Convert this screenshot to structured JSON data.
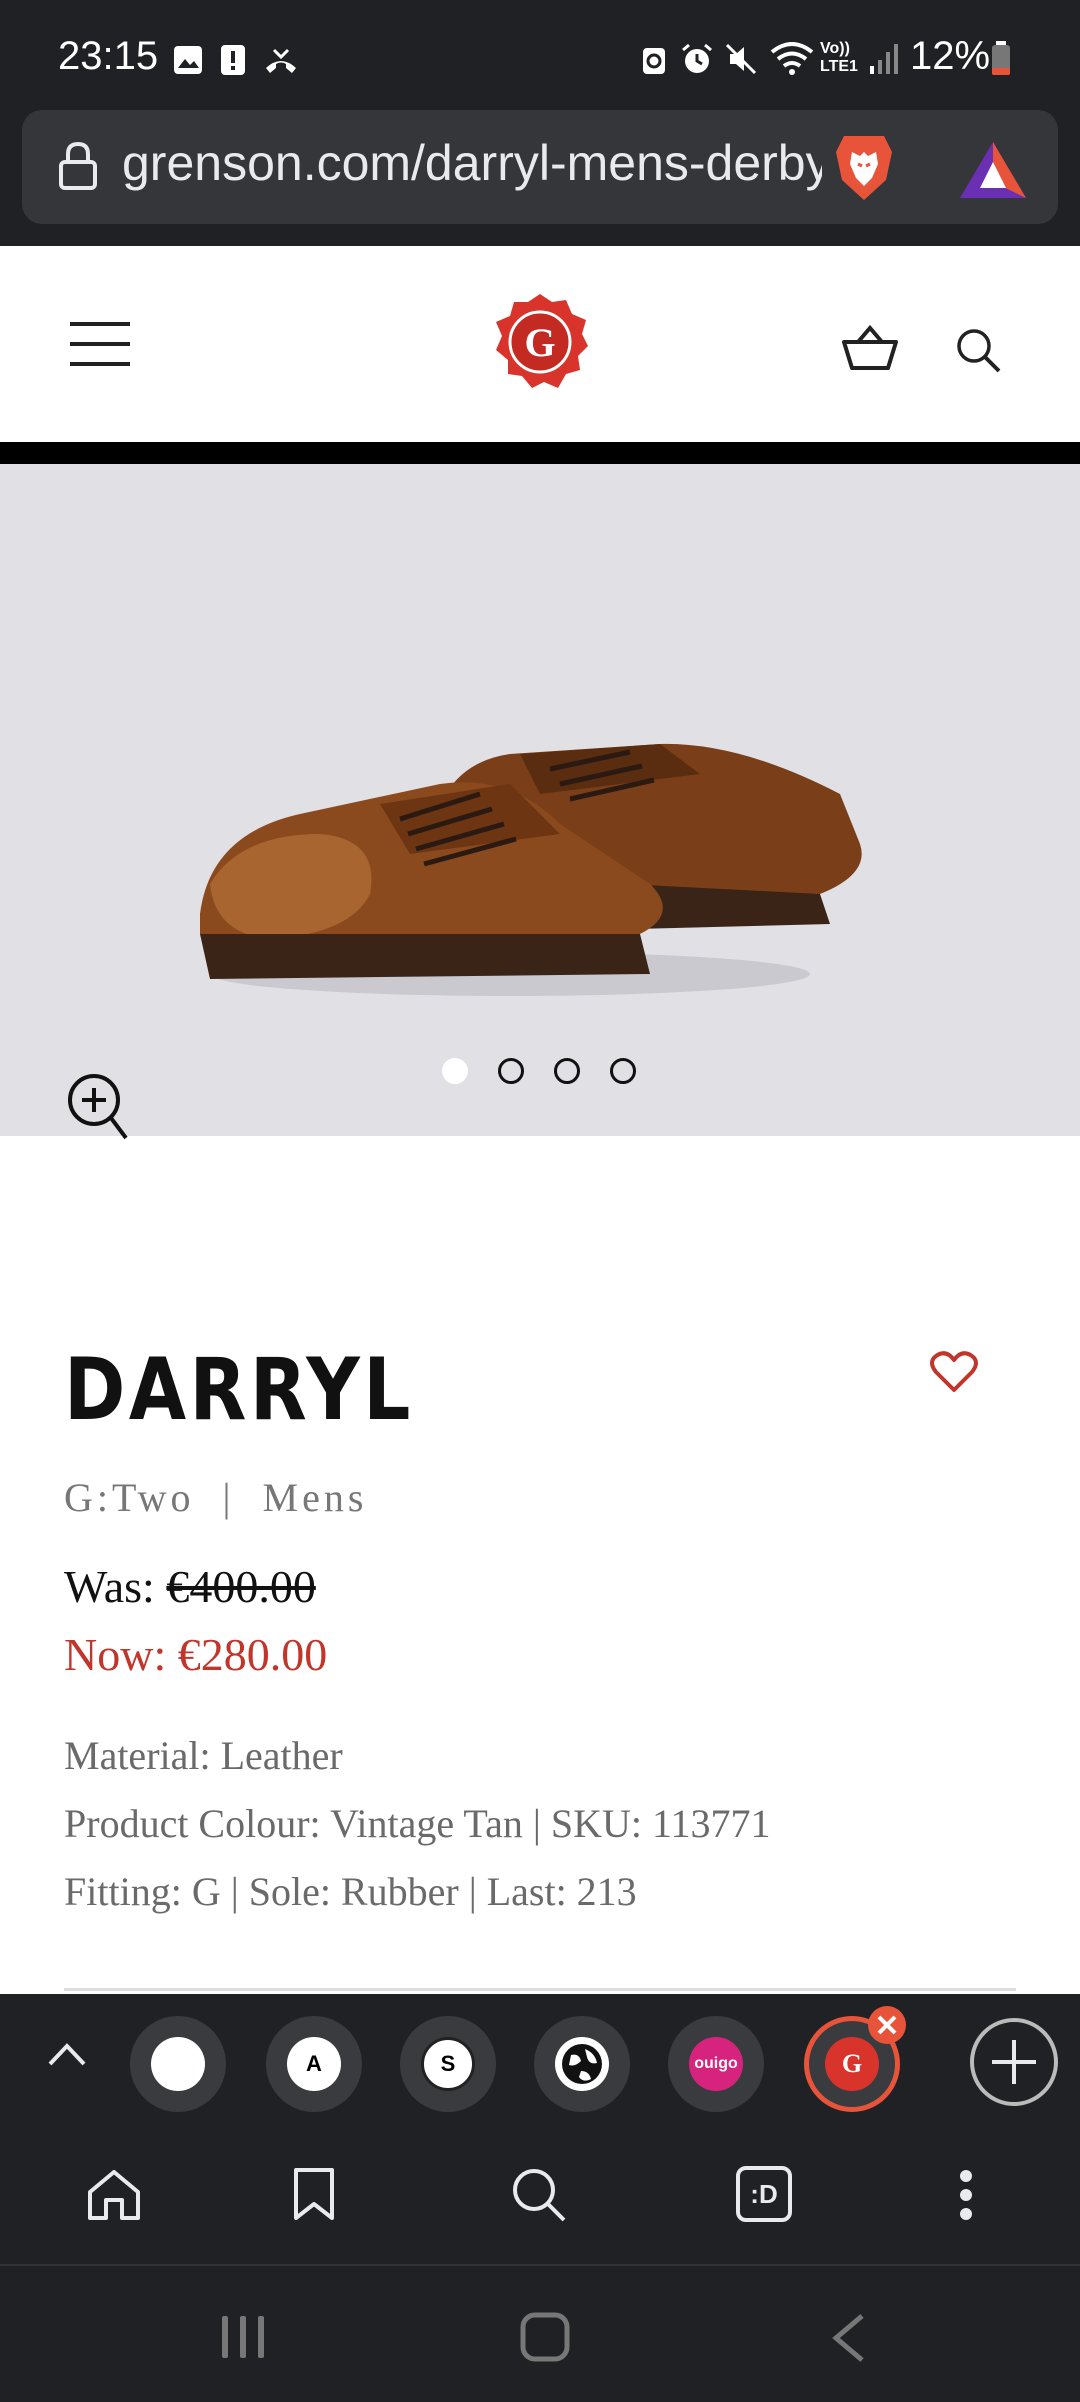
{
  "status_bar": {
    "time": "23:15",
    "battery": "12%",
    "icons": [
      "gallery-icon",
      "alert-icon",
      "missed-call-icon",
      "battery-saver-icon",
      "alarm-icon",
      "mute-icon",
      "wifi-icon",
      "volte-icon",
      "signal-icon",
      "battery-icon"
    ]
  },
  "browser": {
    "url": "grenson.com/darryl-mens-derby",
    "icons": [
      "lock-icon",
      "brave-shield-icon",
      "bat-rewards-icon"
    ]
  },
  "site_header": {
    "brand_letter": "G",
    "icons": [
      "menu-icon",
      "grenson-logo-icon",
      "basket-icon",
      "search-icon"
    ]
  },
  "product": {
    "title": "DARRYL",
    "meta": "G:Two  |  Mens",
    "was_label": "Was: ",
    "was_price": "€400.00",
    "now_price": "Now: €280.00",
    "material": "Material: Leather",
    "colour_sku": "Product Colour: Vintage Tan | SKU: 113771",
    "fitting": "Fitting: G | Sole: Rubber | Last: 213",
    "image_count": 4,
    "active_image": 1
  },
  "tab_strip": {
    "tabs": [
      {
        "label": ""
      },
      {
        "label": "A"
      },
      {
        "label": "S"
      },
      {
        "label": ""
      },
      {
        "label": "ouigo"
      },
      {
        "label": "G"
      }
    ]
  },
  "toolbar": {
    "tabs_label": ":D",
    "icons": [
      "home-icon",
      "bookmark-icon",
      "search-icon",
      "tabs-icon",
      "more-icon"
    ]
  },
  "colors": {
    "accent_red": "#c2352b",
    "brave_orange": "#e8543a",
    "chrome_dark": "#202124"
  }
}
